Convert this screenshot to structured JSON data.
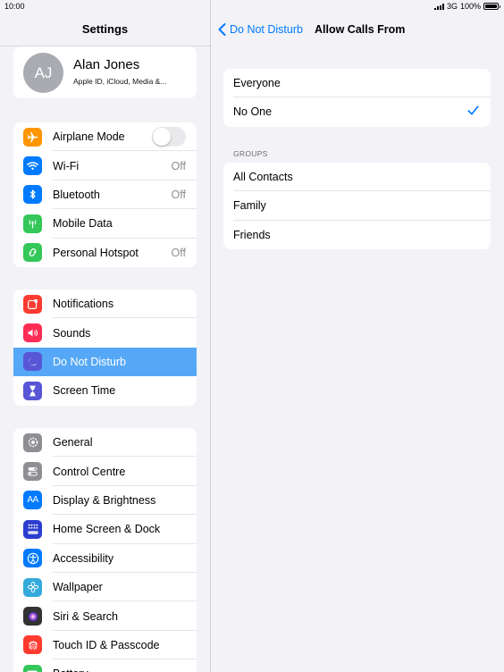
{
  "status": {
    "time": "10:00",
    "network": "3G",
    "battery": "100%"
  },
  "left": {
    "title": "Settings",
    "profile": {
      "initials": "AJ",
      "name": "Alan Jones",
      "subtitle": "Apple ID, iCloud, Media &..."
    },
    "groups": [
      [
        {
          "label": "Airplane Mode",
          "icon": "airplane-icon",
          "color": "#ff9500",
          "toggle": false
        },
        {
          "label": "Wi-Fi",
          "icon": "wifi-icon",
          "color": "#007aff",
          "value": "Off"
        },
        {
          "label": "Bluetooth",
          "icon": "bluetooth-icon",
          "color": "#007aff",
          "value": "Off"
        },
        {
          "label": "Mobile Data",
          "icon": "antenna-icon",
          "color": "#34c759"
        },
        {
          "label": "Personal Hotspot",
          "icon": "hotspot-icon",
          "color": "#34c759",
          "value": "Off"
        }
      ],
      [
        {
          "label": "Notifications",
          "icon": "notifications-icon",
          "color": "#ff3b30"
        },
        {
          "label": "Sounds",
          "icon": "speaker-icon",
          "color": "#ff2d55"
        },
        {
          "label": "Do Not Disturb",
          "icon": "moon-icon",
          "color": "#5856d6",
          "selected": true
        },
        {
          "label": "Screen Time",
          "icon": "hourglass-icon",
          "color": "#5856d6"
        }
      ],
      [
        {
          "label": "General",
          "icon": "gear-icon",
          "color": "#8e8e93"
        },
        {
          "label": "Control Centre",
          "icon": "switches-icon",
          "color": "#8e8e93"
        },
        {
          "label": "Display & Brightness",
          "icon": "text-size-icon",
          "color": "#007aff"
        },
        {
          "label": "Home Screen & Dock",
          "icon": "grid-icon",
          "color": "#2c3ecf"
        },
        {
          "label": "Accessibility",
          "icon": "accessibility-icon",
          "color": "#007aff"
        },
        {
          "label": "Wallpaper",
          "icon": "flower-icon",
          "color": "#34aadc"
        },
        {
          "label": "Siri & Search",
          "icon": "siri-icon",
          "color": "#333333"
        },
        {
          "label": "Touch ID & Passcode",
          "icon": "fingerprint-icon",
          "color": "#ff3b30"
        },
        {
          "label": "Battery",
          "icon": "battery-icon",
          "color": "#34c759"
        }
      ]
    ]
  },
  "right": {
    "back_label": "Do Not Disturb",
    "title": "Allow Calls From",
    "options": [
      {
        "label": "Everyone",
        "checked": false
      },
      {
        "label": "No One",
        "checked": true
      }
    ],
    "groups_header": "GROUPS",
    "groups": [
      {
        "label": "All Contacts"
      },
      {
        "label": "Family"
      },
      {
        "label": "Friends"
      }
    ]
  },
  "colors": {
    "accent": "#007aff",
    "selected_row": "#56a8f6",
    "background": "#f2f2f7"
  }
}
